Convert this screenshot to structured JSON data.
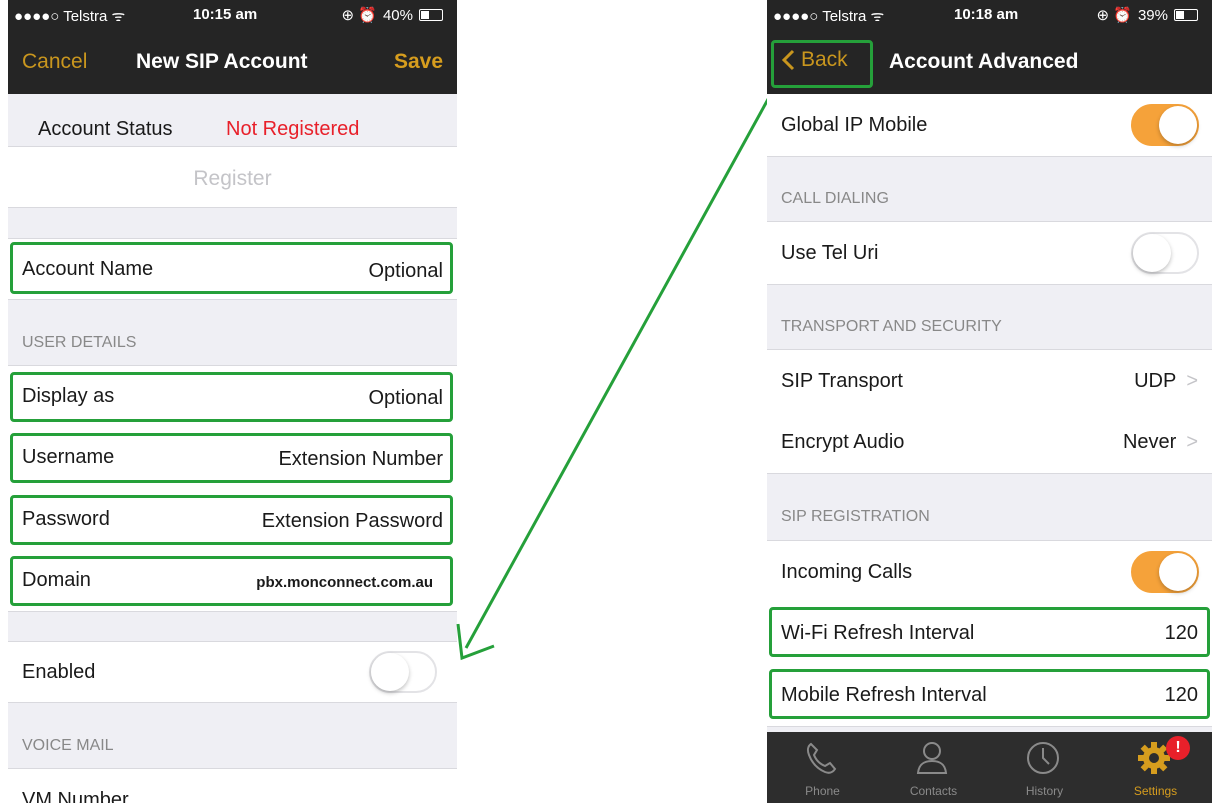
{
  "left": {
    "status": {
      "carrier": "●●●●○ Telstra ᯤ",
      "time": "10:15 am",
      "battery": "40%",
      "battery_level": 0.4
    },
    "nav": {
      "cancel": "Cancel",
      "title": "New SIP Account",
      "save": "Save"
    },
    "account_status_label": "Account Status",
    "account_status_value": "Not Registered",
    "register": "Register",
    "account_name": {
      "label": "Account Name",
      "value": "Optional"
    },
    "user_details_header": "USER DETAILS",
    "display_as": {
      "label": "Display as",
      "value": "Optional"
    },
    "username": {
      "label": "Username",
      "value": "Extension Number"
    },
    "password": {
      "label": "Password",
      "value": "Extension Password"
    },
    "domain": {
      "label": "Domain",
      "value": "pbx.monconnect.com.au"
    },
    "enabled": {
      "label": "Enabled",
      "on": false
    },
    "voice_mail_header": "VOICE MAIL",
    "vm_number": "VM Number"
  },
  "right": {
    "status": {
      "carrier": "●●●●○ Telstra ᯤ",
      "time": "10:18 am",
      "battery": "39%",
      "battery_level": 0.39
    },
    "nav": {
      "back": "Back",
      "title": "Account Advanced"
    },
    "global_ip_mobile": {
      "label": "Global IP Mobile",
      "on": true
    },
    "call_dialing_header": "CALL DIALING",
    "use_tel_uri": {
      "label": "Use Tel Uri",
      "on": false
    },
    "transport_header": "TRANSPORT AND SECURITY",
    "sip_transport": {
      "label": "SIP Transport",
      "value": "UDP"
    },
    "encrypt_audio": {
      "label": "Encrypt Audio",
      "value": "Never"
    },
    "sip_registration_header": "SIP REGISTRATION",
    "incoming_calls": {
      "label": "Incoming Calls",
      "on": true
    },
    "wifi_refresh": {
      "label": "Wi-Fi Refresh Interval",
      "value": "120"
    },
    "mobile_refresh": {
      "label": "Mobile Refresh Interval",
      "value": "120"
    },
    "tabs": [
      {
        "label": "Phone",
        "icon": "phone-icon"
      },
      {
        "label": "Contacts",
        "icon": "contacts-icon"
      },
      {
        "label": "History",
        "icon": "history-icon"
      },
      {
        "label": "Settings",
        "icon": "settings-icon",
        "badge": "!"
      }
    ]
  },
  "colors": {
    "accent": "#d69d1e",
    "highlight": "#25a03a",
    "toggle_on": "#f5a23a",
    "error": "#e8202a"
  }
}
